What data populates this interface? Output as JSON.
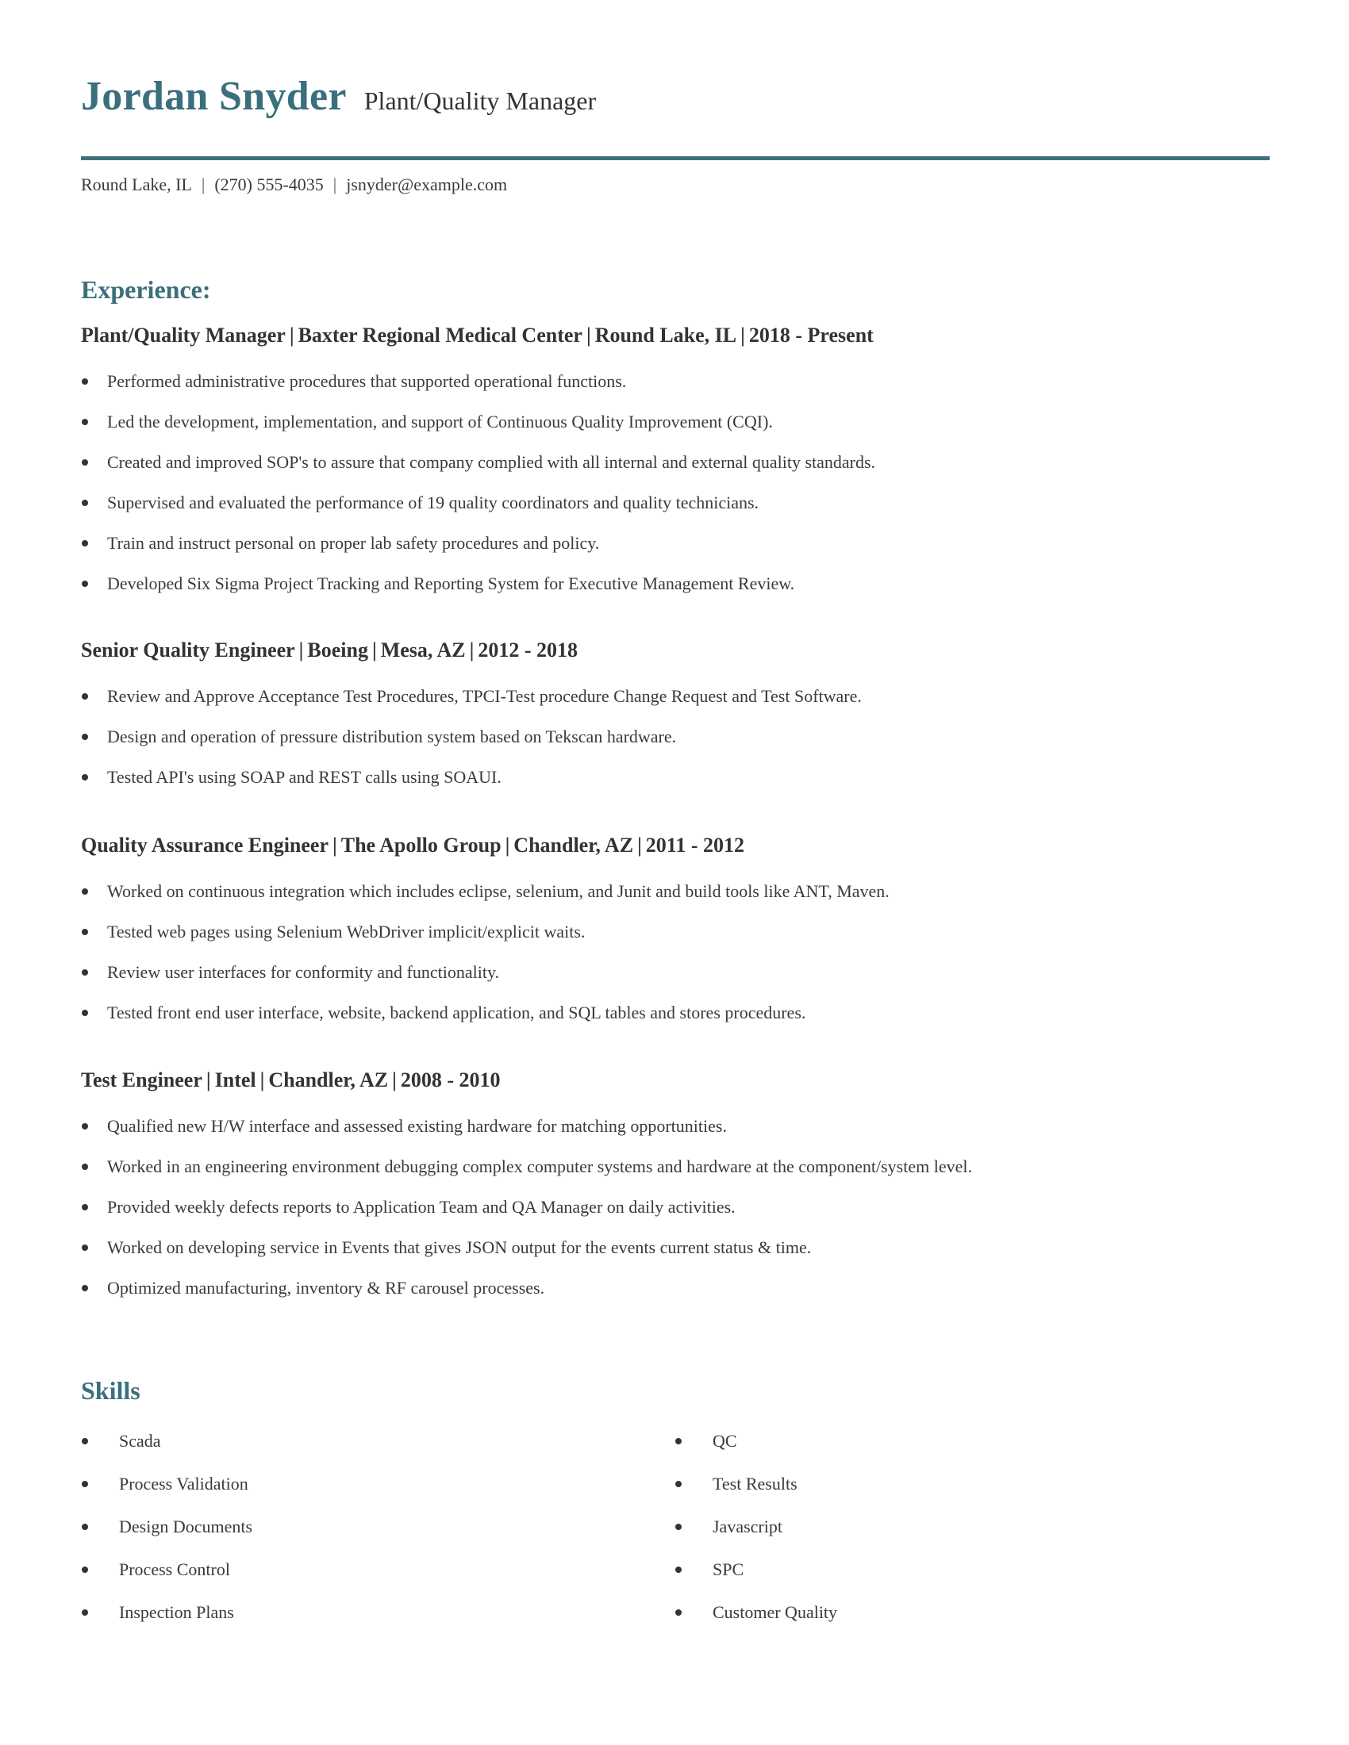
{
  "header": {
    "name": "Jordan Snyder",
    "role": "Plant/Quality Manager"
  },
  "contact": {
    "location": "Round Lake, IL",
    "phone": "(270) 555-4035",
    "email": "jsnyder@example.com",
    "separator": "|"
  },
  "accent_color": "#3a6f7c",
  "experience": {
    "heading": "Experience:",
    "jobs": [
      {
        "title": "Plant/Quality Manager",
        "company": "Baxter Regional Medical Center",
        "location": "Round Lake, IL",
        "dates": "2018 - Present",
        "bullets": [
          "Performed administrative procedures that supported operational functions.",
          "Led the development, implementation, and support of Continuous Quality Improvement (CQI).",
          "Created and improved SOP's to assure that company complied with all internal and external quality standards.",
          "Supervised and evaluated the performance of 19 quality coordinators and quality technicians.",
          "Train and instruct personal on proper lab safety procedures and policy.",
          "Developed Six Sigma Project Tracking and Reporting System for Executive Management Review."
        ]
      },
      {
        "title": "Senior Quality Engineer",
        "company": "Boeing",
        "location": "Mesa, AZ",
        "dates": "2012 - 2018",
        "bullets": [
          "Review and Approve Acceptance Test Procedures, TPCI-Test procedure Change Request and Test Software.",
          "Design and operation of pressure distribution system based on Tekscan hardware.",
          "Tested API's using SOAP and REST calls using SOAUI."
        ]
      },
      {
        "title": "Quality Assurance Engineer",
        "company": "The Apollo Group",
        "location": "Chandler, AZ",
        "dates": "2011 - 2012",
        "bullets": [
          "Worked on continuous integration which includes eclipse, selenium, and Junit and build tools like ANT, Maven.",
          "Tested web pages using Selenium WebDriver implicit/explicit waits.",
          "Review user interfaces for conformity and functionality.",
          "Tested front end user interface, website, backend application, and SQL tables and stores procedures."
        ]
      },
      {
        "title": "Test Engineer",
        "company": "Intel",
        "location": "Chandler, AZ",
        "dates": "2008 - 2010",
        "bullets": [
          "Qualified new H/W interface and assessed existing hardware for matching opportunities.",
          "Worked in an engineering environment debugging complex computer systems and hardware at the component/system level.",
          "Provided weekly defects reports to Application Team and QA Manager on daily activities.",
          "Worked on developing service in Events that gives JSON output for the events current status & time.",
          "Optimized manufacturing, inventory & RF carousel processes."
        ]
      }
    ]
  },
  "skills": {
    "heading": "Skills",
    "left": [
      "Scada",
      "Process Validation",
      "Design Documents",
      "Process Control",
      "Inspection Plans"
    ],
    "right": [
      "QC",
      "Test Results",
      "Javascript",
      "SPC",
      "Customer Quality"
    ]
  }
}
